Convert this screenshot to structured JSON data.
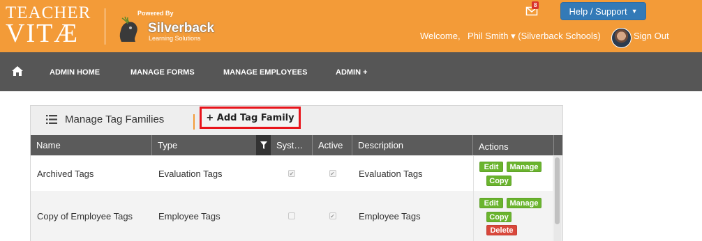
{
  "header": {
    "logo_line1": "TEACHER",
    "logo_line2": "VITÆ",
    "powered_by": "Powered By",
    "brand_name": "Silverback",
    "brand_sub": "Learning Solutions",
    "notification_count": "8",
    "help_label": "Help / Support",
    "welcome": "Welcome,",
    "user": "Phil Smith ▾ (Silverback Schools)",
    "sign_out": "Sign Out",
    "colors": {
      "header_bg": "#f39b38",
      "help_btn": "#337ab7",
      "badge": "#d9342b"
    }
  },
  "nav": {
    "home_icon": "home-icon",
    "items": [
      "ADMIN HOME",
      "MANAGE FORMS",
      "MANAGE EMPLOYEES",
      "ADMIN +"
    ]
  },
  "panel": {
    "title": "Manage Tag Families",
    "title_icon": "list-icon",
    "add_button": "+ Add Tag Family"
  },
  "table": {
    "columns": [
      "Name",
      "Type",
      "Syst…",
      "Active",
      "Description",
      "Actions"
    ],
    "rows": [
      {
        "name": "Archived Tags",
        "type": "Evaluation Tags",
        "system": true,
        "active": true,
        "description": "Evaluation Tags",
        "actions": [
          "Edit",
          "Manage",
          "Copy"
        ]
      },
      {
        "name": "Copy of Employee Tags",
        "type": "Employee Tags",
        "system": false,
        "active": true,
        "description": "Employee Tags",
        "actions": [
          "Edit",
          "Manage",
          "Copy",
          "Delete"
        ]
      }
    ]
  }
}
